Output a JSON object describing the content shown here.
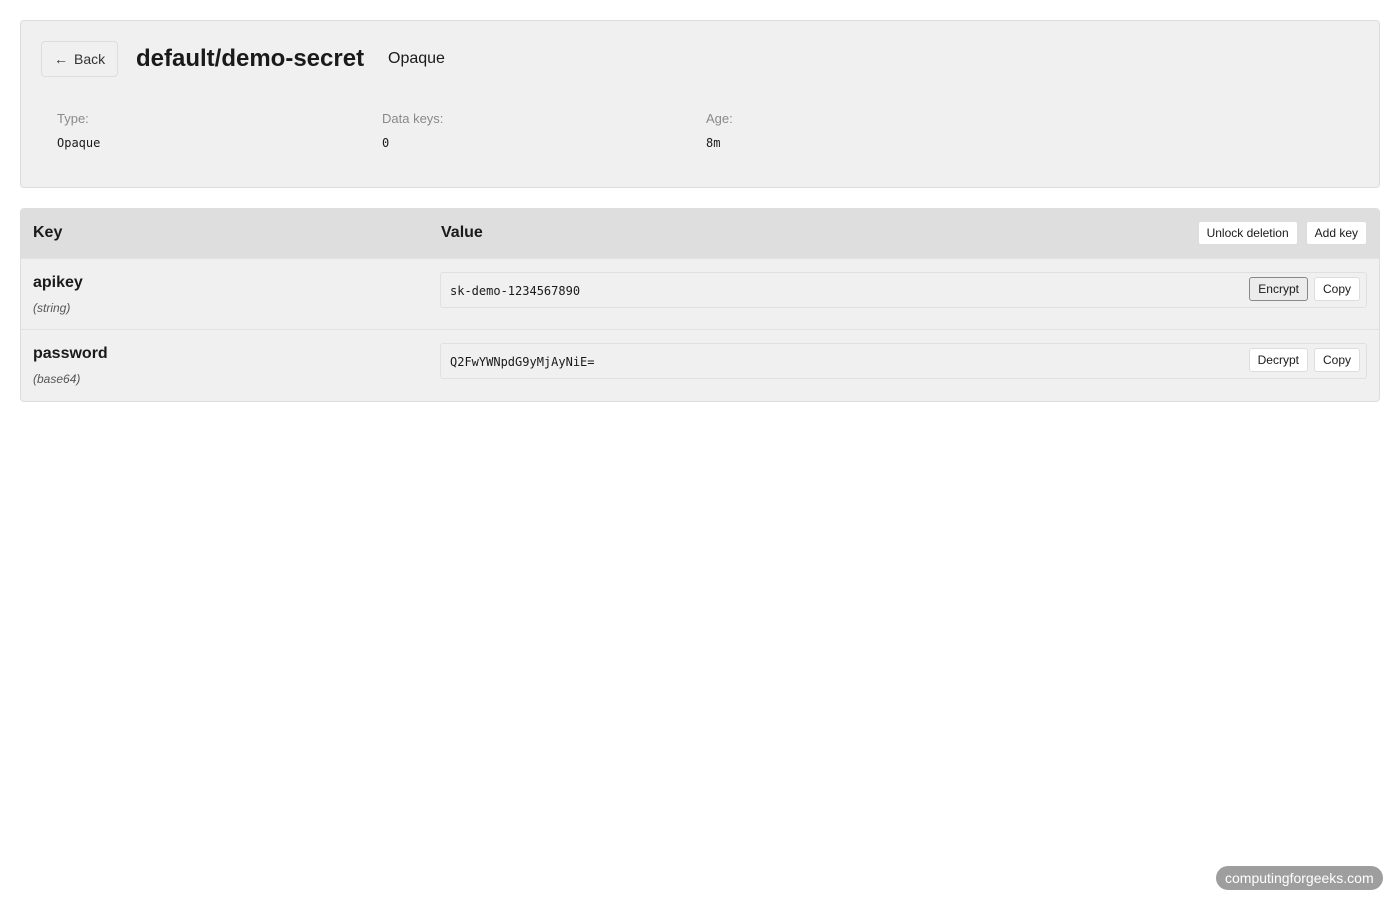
{
  "header": {
    "back_label": "Back",
    "back_icon": "left-arrow-icon",
    "title": "default/demo-secret",
    "type_badge": "Opaque",
    "meta": {
      "type_label": "Type:",
      "type_value": "Opaque",
      "keys_label": "Data keys:",
      "keys_value": "0",
      "age_label": "Age:",
      "age_value": "8m"
    }
  },
  "table": {
    "columns": {
      "key": "Key",
      "value": "Value"
    },
    "actions": {
      "unlock_deletion": "Unlock deletion",
      "add_key": "Add key"
    },
    "rows": [
      {
        "key": "apikey",
        "encoding": "(string)",
        "value": "sk-demo-1234567890",
        "primary_action": "Encrypt",
        "copy_action": "Copy"
      },
      {
        "key": "password",
        "encoding": "(base64)",
        "value": "Q2FwYWNpdG9yMjAyNiE=",
        "primary_action": "Decrypt",
        "copy_action": "Copy"
      }
    ]
  },
  "watermark": {
    "text": "computingforgeeks.com"
  },
  "colors": {
    "page_bg": "#ffffff",
    "card_bg": "#f0f0f0",
    "table_header_bg": "#dedede",
    "border": "#dddddd",
    "muted_text": "#8a8a8a",
    "watermark_bg": "#9e9e9e"
  }
}
